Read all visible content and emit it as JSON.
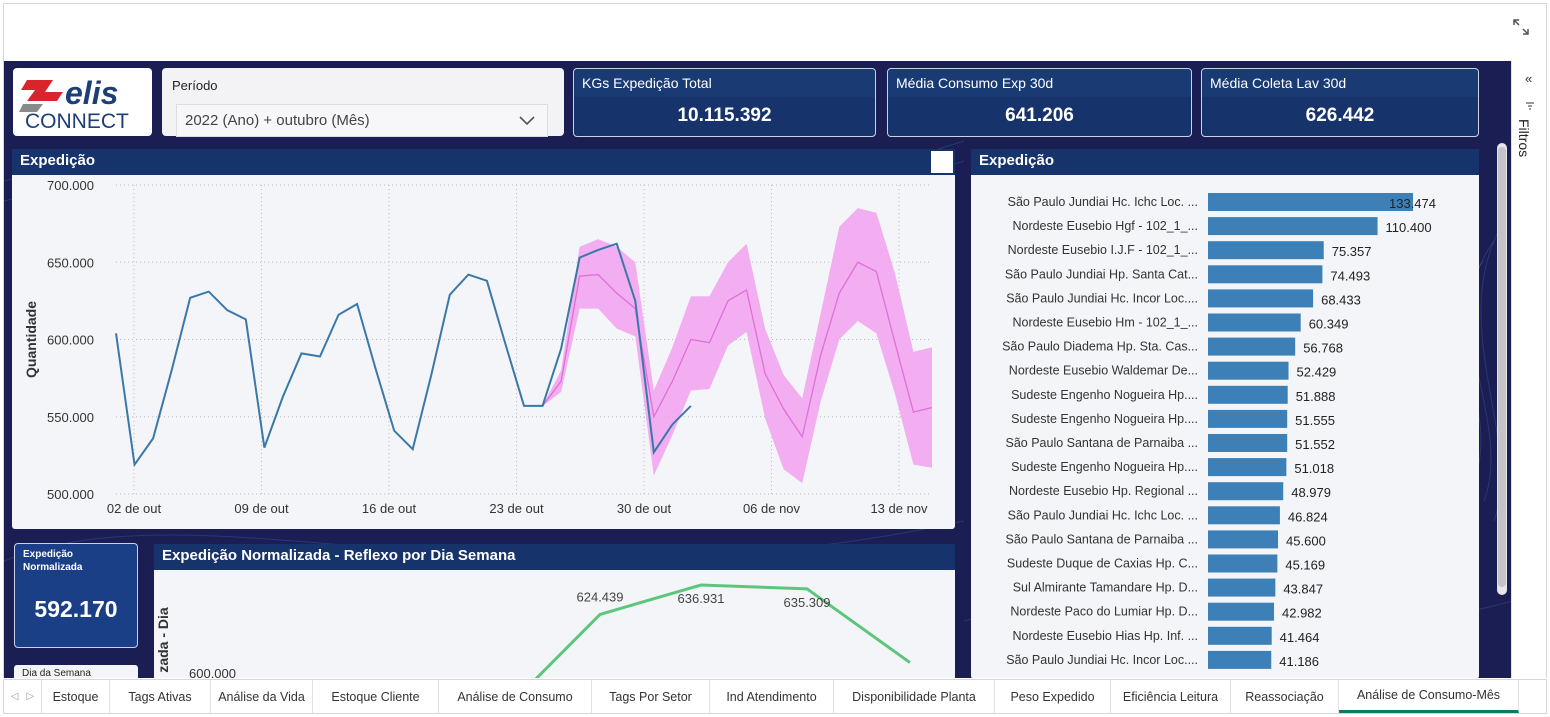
{
  "logo": {
    "top": "elis",
    "bottom": "CONNECT"
  },
  "filtro": {
    "label": "Período",
    "value": "2022 (Ano) + outubro (Mês)"
  },
  "kpis": [
    {
      "label": "KGs Expedição Total",
      "value": "10.115.392"
    },
    {
      "label": "Média Consumo Exp 30d",
      "value": "641.206"
    },
    {
      "label": "Média Coleta Lav 30d",
      "value": "626.442"
    }
  ],
  "line_panel": {
    "title": "Expedição",
    "ylabel": "Quantidade"
  },
  "bar_panel": {
    "title": "Expedição"
  },
  "norm_card": {
    "label": "Expedição Normalizada",
    "value": "592.170"
  },
  "dia_card": {
    "label": "Dia da Semana"
  },
  "bottom_panel": {
    "title": "Expedição Normalizada - Reflexo por Dia Semana",
    "ylabel": "zada - Dia"
  },
  "filter_pane": {
    "label": "Filtros"
  },
  "tabs": [
    "Estoque",
    "Tags Ativas",
    "Análise da Vida",
    "Estoque Cliente",
    "Análise de Consumo",
    "Tags Por Setor",
    "Ind Atendimento",
    "Disponibilidade Planta",
    "Peso Expedido",
    "Eficiência Leitura",
    "Reassociação",
    "Análise de Consumo-Mês"
  ],
  "active_tab": "Análise de Consumo-Mês",
  "colors": {
    "navy": "#16336b",
    "line": "#3a78a8",
    "forecast_band": "#f2a6f0",
    "forecast_line": "#e06fd8",
    "bar": "#3d80b8",
    "green": "#5cc67d",
    "tab_active": "#117865"
  },
  "chart_data": [
    {
      "type": "line",
      "title": "Expedição",
      "ylabel": "Quantidade",
      "ylim": [
        500000,
        700000
      ],
      "yticks": [
        "700.000",
        "650.000",
        "600.000",
        "550.000",
        "500.000"
      ],
      "xticks": [
        "02 de out",
        "09 de out",
        "16 de out",
        "23 de out",
        "30 de out",
        "06 de nov",
        "13 de nov"
      ],
      "grid": true,
      "series": [
        {
          "values": [
            604000,
            519000,
            536000,
            580000,
            627000,
            631000,
            619000,
            613000,
            530000,
            563000,
            591000,
            589000,
            616000,
            623000,
            581000,
            541000,
            529000,
            577000,
            629000,
            642000,
            638000,
            597000,
            557000,
            557000,
            594000,
            653000,
            658000,
            662000,
            625000,
            527000,
            545000,
            557000
          ]
        },
        {
          "start_index": 23,
          "values": [
            557000,
            573000,
            641000,
            642000,
            630000,
            620000,
            550000,
            573000,
            600000,
            598000,
            625000,
            632000,
            578000,
            555000,
            537000,
            590000,
            630000,
            650000,
            644000,
            598000,
            553000,
            556000
          ]
        }
      ],
      "band_upper": [
        557000,
        580000,
        660000,
        665000,
        660000,
        650000,
        567000,
        595000,
        628000,
        628000,
        650000,
        662000,
        607000,
        577000,
        562000,
        617000,
        673000,
        685000,
        682000,
        643000,
        592000,
        595000
      ],
      "band_lower": [
        557000,
        566000,
        620000,
        620000,
        607000,
        602000,
        512000,
        538000,
        567000,
        568000,
        596000,
        605000,
        549000,
        516000,
        507000,
        560000,
        600000,
        612000,
        604000,
        565000,
        519000,
        517000
      ]
    },
    {
      "type": "bar",
      "title": "Expedição",
      "categories": [
        "São Paulo Jundiai Hc. Ichc Loc. ...",
        "Nordeste Eusebio Hgf - 102_1_...",
        "Nordeste Eusebio I.J.F - 102_1_...",
        "São Paulo Jundiai Hp. Santa Cat...",
        "São Paulo Jundiai Hc. Incor Loc....",
        "Nordeste Eusebio Hm - 102_1_...",
        "São Paulo Diadema Hp. Sta. Cas...",
        "Nordeste Eusebio Waldemar De...",
        "Sudeste Engenho Nogueira Hp....",
        "Sudeste Engenho Nogueira Hp....",
        "São Paulo Santana de Parnaiba ...",
        "Sudeste Engenho Nogueira Hp....",
        "Nordeste Eusebio Hp. Regional ...",
        "São Paulo Jundiai Hc. Ichc Loc. ...",
        "São Paulo Santana de Parnaiba ...",
        "Sudeste Duque de Caxias Hp. C...",
        "Sul Almirante Tamandare Hp. D...",
        "Nordeste Paco do Lumiar Hp. D...",
        "Nordeste Eusebio Hias Hp. Inf. ...",
        "São Paulo Jundiai Hc. Incor Loc...."
      ],
      "values": [
        133474,
        110400,
        75357,
        74493,
        68433,
        60349,
        56768,
        52429,
        51888,
        51555,
        51552,
        51018,
        48979,
        46824,
        45600,
        45169,
        43847,
        42982,
        41464,
        41186
      ],
      "labels": [
        "133.474",
        "110.400",
        "75.357",
        "74.493",
        "68.433",
        "60.349",
        "56.768",
        "52.429",
        "51.888",
        "51.555",
        "51.552",
        "51.018",
        "48.979",
        "46.824",
        "45.600",
        "45.169",
        "43.847",
        "42.982",
        "41.464",
        "41.186"
      ]
    },
    {
      "type": "line",
      "title": "Expedição Normalizada - Reflexo por Dia Semana",
      "ytick_visible": "600.000",
      "values": [
        592000,
        624439,
        636931,
        635309,
        604000
      ],
      "labels": [
        "",
        "624.439",
        "636.931",
        "635.309",
        ""
      ]
    }
  ]
}
